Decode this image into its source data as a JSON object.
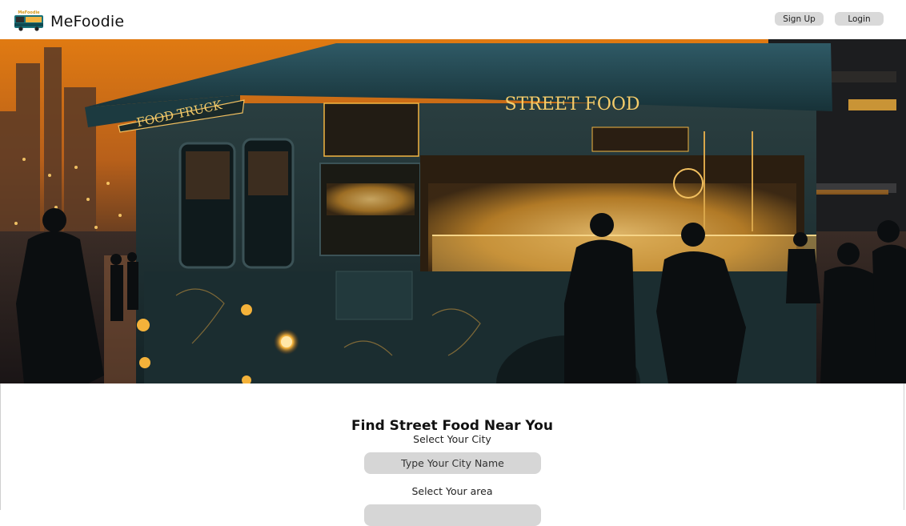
{
  "header": {
    "brand": "MeFoodie",
    "logo_icon": "food-truck-logo-icon",
    "signup_label": "Sign Up",
    "login_label": "Login"
  },
  "hero": {
    "image": "food-truck-night-scene",
    "sign_text_left": "FOOD TRUCK",
    "sign_text_top": "STREET FOOD"
  },
  "search": {
    "title": "Find Street Food Near You",
    "city_label": "Select Your City",
    "city_placeholder": "Type Your City Name",
    "area_label": "Select Your area",
    "area_placeholder": ""
  },
  "colors": {
    "button_bg": "#d9d9d9",
    "input_bg": "#d6d6d6",
    "hero_sky": "#e88a1e",
    "truck_teal": "#1f3a40",
    "glow_gold": "#f2b542"
  }
}
